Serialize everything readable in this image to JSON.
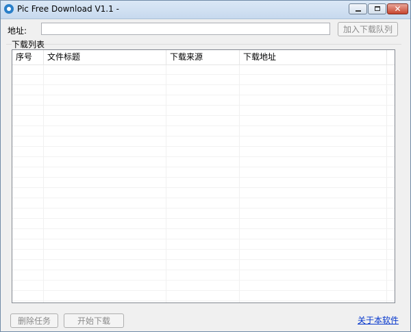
{
  "window": {
    "title": "Pic Free Download V1.1 -"
  },
  "address": {
    "label": "地址:",
    "value": "",
    "placeholder": ""
  },
  "buttons": {
    "enqueue": "加入下载队列",
    "delete_task": "删除任务",
    "start_download": "开始下载"
  },
  "list": {
    "group_title": "下载列表",
    "columns": [
      "序号",
      "文件标题",
      "下载来源",
      "下载地址"
    ],
    "rows": []
  },
  "about_link": "关于本软件",
  "colors": {
    "titlebar": "#c7d9ee",
    "link": "#0033cc",
    "disabled_text": "#8a8a8a"
  },
  "icons": {
    "app": "app-icon",
    "minimize": "minimize-icon",
    "maximize": "maximize-icon",
    "close": "close-icon"
  }
}
